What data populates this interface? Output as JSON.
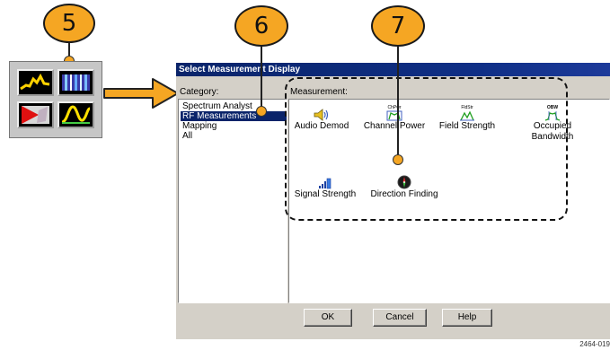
{
  "callouts": [
    "5",
    "6",
    "7"
  ],
  "dialog": {
    "title": "Select Measurement Display",
    "category_label": "Category:",
    "measurement_label": "Measurement:",
    "categories": [
      "Spectrum Analyst",
      "RF Measurements",
      "Mapping",
      "All"
    ],
    "selected_category": "RF Measurements",
    "measurements": [
      {
        "label": "Audio Demod",
        "icon": "speaker-icon"
      },
      {
        "label": "Channel Power",
        "icon": "channel-power-icon",
        "icon_text": "ChPwr"
      },
      {
        "label": "Field Strength",
        "icon": "field-strength-icon",
        "icon_text": "FldStr"
      },
      {
        "label": "Occupied Bandwidth",
        "icon": "occupied-bandwidth-icon",
        "icon_text": "OBW"
      },
      {
        "label": "Signal Strength",
        "icon": "signal-bars-icon"
      },
      {
        "label": "Direction Finding",
        "icon": "compass-icon"
      }
    ],
    "buttons": {
      "ok": "OK",
      "cancel": "Cancel",
      "help": "Help"
    }
  },
  "figure_number": "2464-019",
  "colors": {
    "callout": "#f5a623",
    "titlebar": "#0a246a",
    "selection": "#0a246a",
    "dialog_bg": "#d4d0c8"
  }
}
